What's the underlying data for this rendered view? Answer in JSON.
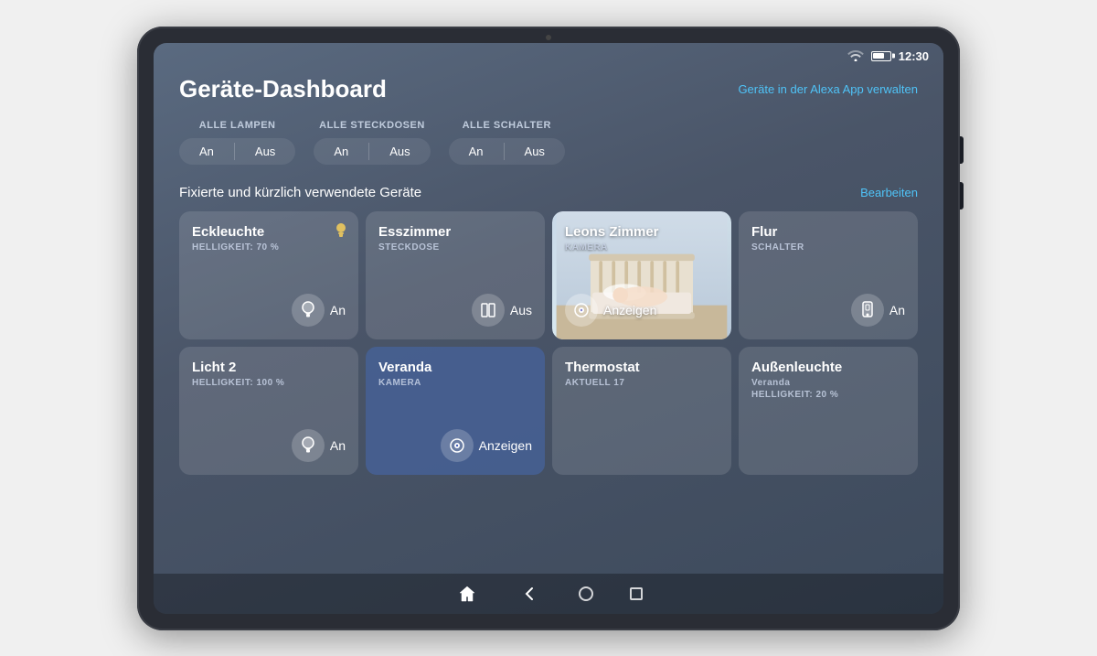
{
  "tablet": {
    "time": "12:30"
  },
  "header": {
    "title": "Geräte-Dashboard",
    "manage_link": "Geräte in der Alexa App verwalten"
  },
  "quick_controls": [
    {
      "label": "ALLE LAMPEN",
      "on": "An",
      "off": "Aus"
    },
    {
      "label": "ALLE STECKDOSEN",
      "on": "An",
      "off": "Aus"
    },
    {
      "label": "ALLE SCHALTER",
      "on": "An",
      "off": "Aus"
    }
  ],
  "section": {
    "title": "Fixierte und kürzlich verwendete Geräte",
    "edit": "Bearbeiten"
  },
  "devices": [
    {
      "name": "Eckleuchte",
      "type_label": "HELLIGKEIT: 70 %",
      "status": "An",
      "icon": "💡",
      "has_image": false,
      "highlighted": false
    },
    {
      "name": "Esszimmer",
      "type_label": "STECKDOSE",
      "status": "Aus",
      "icon": "⏸",
      "has_image": false,
      "highlighted": false
    },
    {
      "name": "Leons Zimmer",
      "type_label": "KAMERA",
      "status": "Anzeigen",
      "icon": "📷",
      "has_image": true,
      "highlighted": false
    },
    {
      "name": "Flur",
      "type_label": "SCHALTER",
      "status": "An",
      "icon": "📱",
      "has_image": false,
      "highlighted": false
    },
    {
      "name": "Licht 2",
      "type_label": "HELLIGKEIT: 100 %",
      "status": "An",
      "icon": "💡",
      "has_image": false,
      "highlighted": false
    },
    {
      "name": "Veranda",
      "type_label": "KAMERA",
      "status": "Anzeigen",
      "icon": "📷",
      "has_image": false,
      "highlighted": true
    },
    {
      "name": "Thermostat",
      "type_label": "AKTUELL 17",
      "status": "",
      "icon": "🌡",
      "has_image": false,
      "highlighted": false
    },
    {
      "name": "Außenleuchte",
      "type_label": "Veranda",
      "type_sub": "HELLIGKEIT: 20 %",
      "status": "",
      "icon": "💡",
      "has_image": false,
      "highlighted": false
    }
  ],
  "bottom_nav": {
    "back": "◀",
    "home": "⌂"
  }
}
